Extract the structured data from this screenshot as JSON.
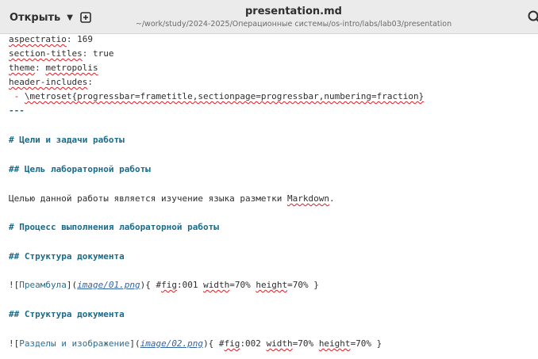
{
  "header": {
    "open_label": "Открыть",
    "title": "presentation.md",
    "path": "~/work/study/2024-2025/Операционные системы/os-intro/labs/lab03/presentation"
  },
  "icons": {
    "open_caret": "chevron-down-icon",
    "new_tab": "new-document-icon",
    "search": "search-icon"
  },
  "editor": {
    "lines": [
      {
        "key": "aspectratio",
        "rest": ": 169"
      },
      {
        "key": "section-titles",
        "rest": ": true"
      },
      {
        "key": "theme",
        "rest": ": ",
        "value": "metropolis"
      },
      {
        "key": "header-includes",
        "rest": ":"
      },
      {
        "bullet": " - ",
        "text": "\\metroset{progressbar=frametitle,sectionpage=progressbar,numbering=fraction}"
      },
      {
        "text": "---"
      },
      {
        "text": ""
      },
      {
        "text": "# Цели и задачи работы"
      },
      {
        "text": ""
      },
      {
        "text": "## Цель лабораторной работы"
      },
      {
        "text": ""
      },
      {
        "pre": "Целью данной работы является изучение языка разметки ",
        "sq": "Markdown",
        "post": "."
      },
      {
        "text": ""
      },
      {
        "text": "# Процесс выполнения лабораторной работы"
      },
      {
        "text": ""
      },
      {
        "text": "## Структура документа"
      },
      {
        "text": ""
      },
      {
        "open": "![",
        "label": "Преамбула",
        "mid": "](",
        "url": "image/01.png",
        "close": "){ #",
        "fig": "fig",
        "id": ":001 ",
        "w": "width",
        "wv": "=70% ",
        "h": "height",
        "hv": "=70% }"
      },
      {
        "text": ""
      },
      {
        "text": "## Структура документа"
      },
      {
        "text": ""
      },
      {
        "open": "![",
        "label": "Разделы и изображение",
        "mid": "](",
        "url": "image/02.png",
        "close": "){ #",
        "fig": "fig",
        "id": ":002 ",
        "w": "width",
        "wv": "=70% ",
        "h": "height",
        "hv": "=70% }"
      }
    ]
  }
}
